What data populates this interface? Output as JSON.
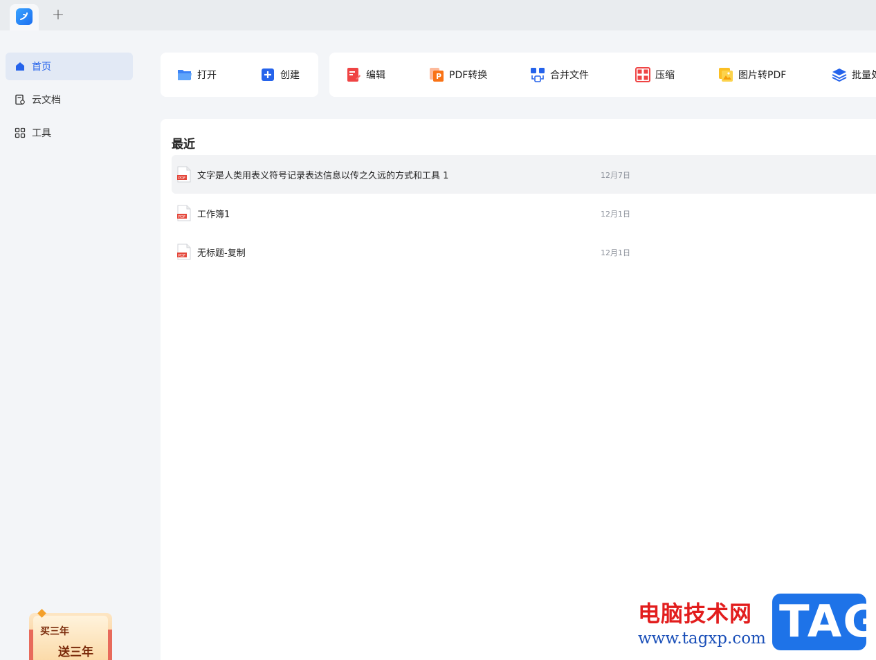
{
  "titlebar": {
    "new_tab_label": "+"
  },
  "sidebar": {
    "items": [
      {
        "label": "首页",
        "icon": "home-icon",
        "active": true
      },
      {
        "label": "云文档",
        "icon": "cloud-doc-icon",
        "active": false
      },
      {
        "label": "工具",
        "icon": "grid-icon",
        "active": false
      }
    ],
    "promo": {
      "line1": "买三年",
      "line2": "送三年"
    }
  },
  "toolbar": {
    "open": "打开",
    "create": "创建",
    "edit": "编辑",
    "pdf_convert": "PDF转换",
    "merge": "合并文件",
    "compress": "压缩",
    "image_to_pdf": "图片转PDF",
    "batch": "批量处"
  },
  "recent": {
    "title": "最近",
    "files": [
      {
        "name": "文字是人类用表义符号记录表达信息以传之久远的方式和工具 1",
        "date": "12月7日",
        "icon_label": "PDF"
      },
      {
        "name": "工作簿1",
        "date": "12月1日",
        "icon_label": "PDF"
      },
      {
        "name": "无标题-复制",
        "date": "12月1日",
        "icon_label": "PDF"
      }
    ]
  },
  "watermark": {
    "cn": "电脑技术网",
    "url": "www.tagxp.com",
    "tag": "TAG"
  },
  "colors": {
    "accent": "#2563eb",
    "pdf_red": "#e4463a",
    "active_bg": "#e2e9f5"
  }
}
